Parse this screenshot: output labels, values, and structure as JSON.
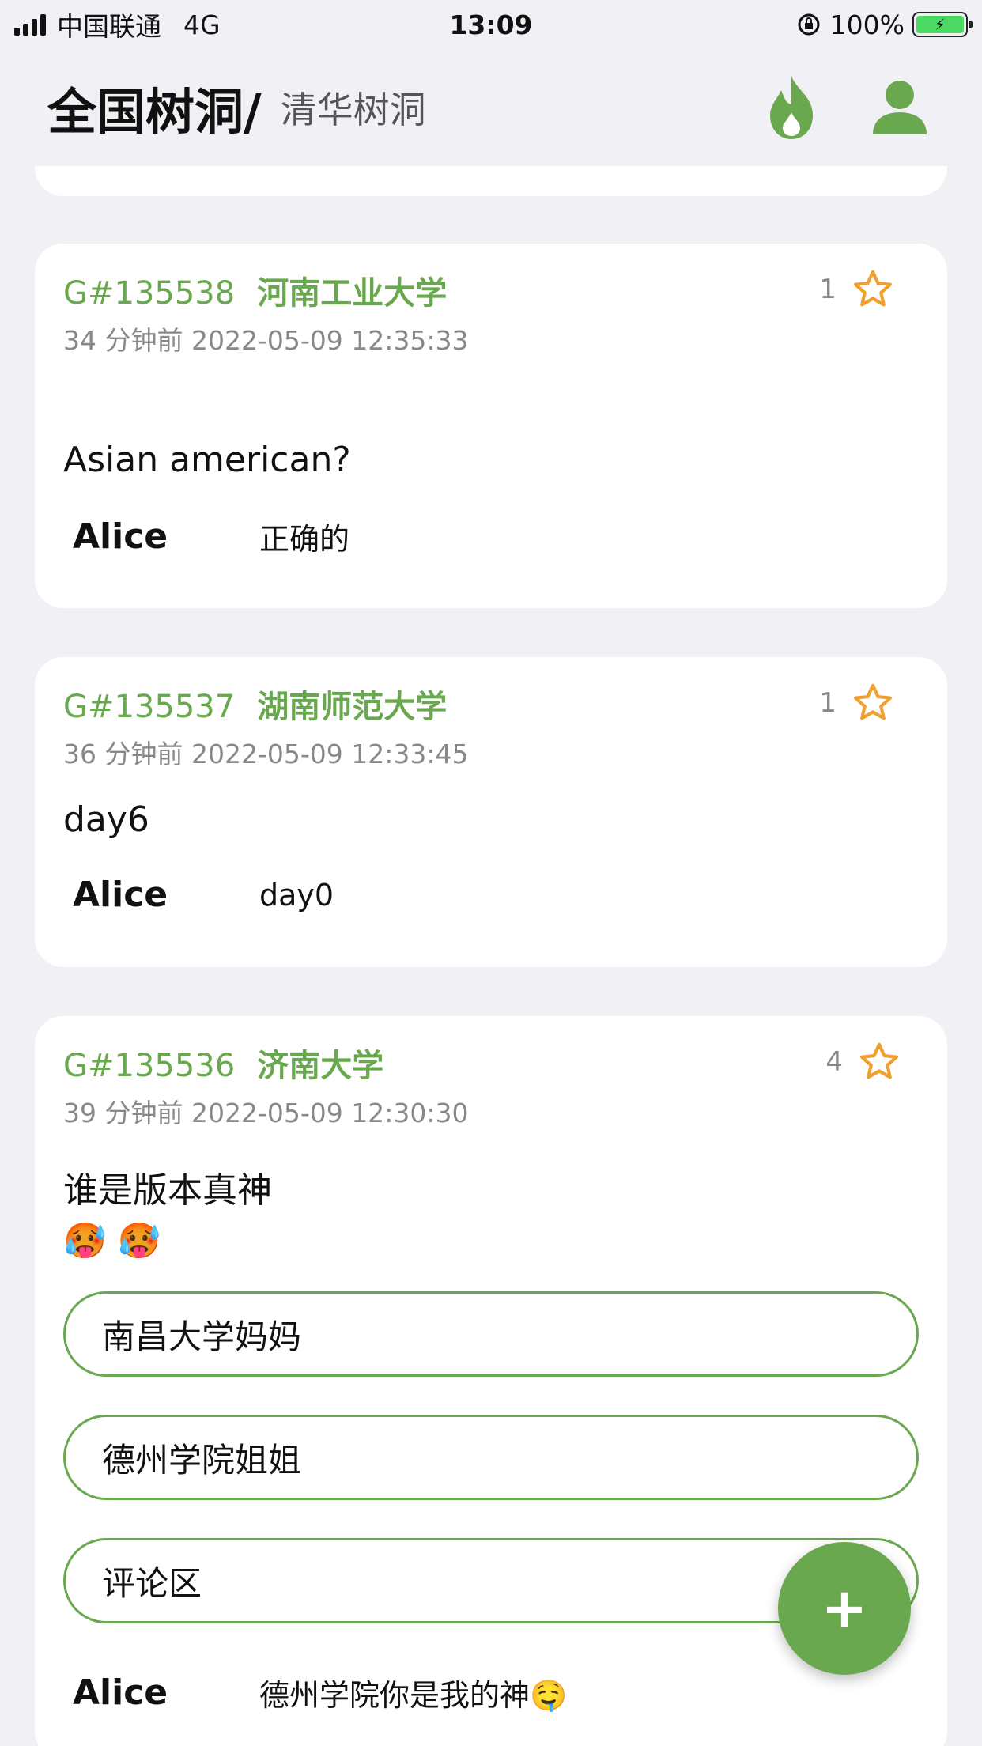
{
  "status_bar": {
    "carrier": "中国联通",
    "network": "4G",
    "time": "13:09",
    "battery": "100%"
  },
  "header": {
    "title": "全国树洞/",
    "subtitle": "清华树洞",
    "fire_icon": "fire-icon",
    "user_icon": "user-icon",
    "accent": "#6aa84f"
  },
  "posts": [
    {
      "id": "G#135538",
      "school": "河南工业大学",
      "time": "34 分钟前 2022-05-09 12:35:33",
      "stars": "1",
      "content": "Asian american?",
      "comment": {
        "author": "Alice",
        "text": "正确的"
      }
    },
    {
      "id": "G#135537",
      "school": "湖南师范大学",
      "time": "36 分钟前 2022-05-09 12:33:45",
      "stars": "1",
      "content": "day6",
      "comment": {
        "author": "Alice",
        "text": "day0"
      }
    },
    {
      "id": "G#135536",
      "school": "济南大学",
      "time": "39 分钟前 2022-05-09 12:30:30",
      "stars": "4",
      "content": "谁是版本真神",
      "emoji": "🥵 🥵",
      "poll_options": [
        "南昌大学妈妈",
        "德州学院姐姐",
        "评论区"
      ],
      "comment": {
        "author": "Alice",
        "text": "德州学院你是我的神🤤"
      }
    }
  ],
  "fab": {
    "label": "+"
  },
  "colors": {
    "accent": "#6aa84f",
    "star": "#f0a030",
    "background": "#f1f1f5"
  }
}
